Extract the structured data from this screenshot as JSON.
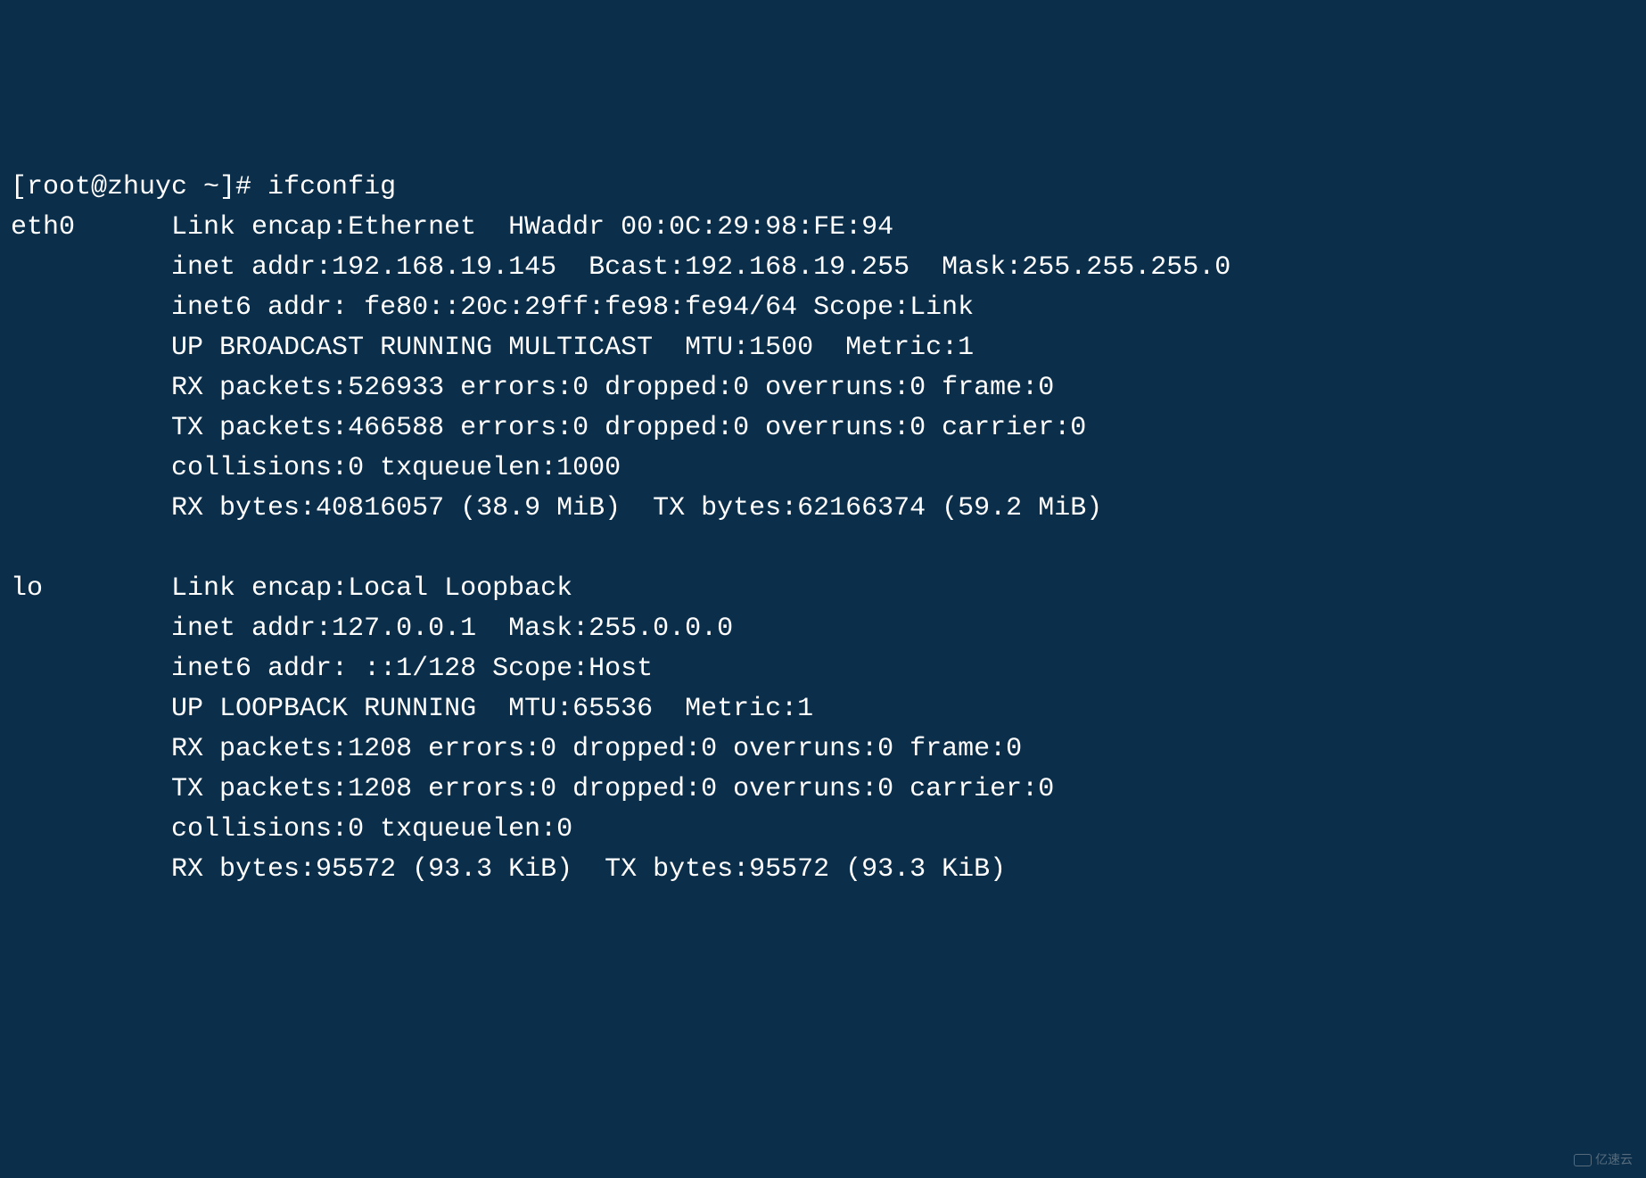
{
  "prompt": "[root@zhuyc ~]# ifconfig",
  "interfaces": {
    "eth0": {
      "name": "eth0",
      "line1": "Link encap:Ethernet  HWaddr 00:0C:29:98:FE:94",
      "line2": "inet addr:192.168.19.145  Bcast:192.168.19.255  Mask:255.255.255.0",
      "line3": "inet6 addr: fe80::20c:29ff:fe98:fe94/64 Scope:Link",
      "line4": "UP BROADCAST RUNNING MULTICAST  MTU:1500  Metric:1",
      "line5": "RX packets:526933 errors:0 dropped:0 overruns:0 frame:0",
      "line6": "TX packets:466588 errors:0 dropped:0 overruns:0 carrier:0",
      "line7": "collisions:0 txqueuelen:1000",
      "line8": "RX bytes:40816057 (38.9 MiB)  TX bytes:62166374 (59.2 MiB)"
    },
    "lo": {
      "name": "lo",
      "line1": "Link encap:Local Loopback",
      "line2": "inet addr:127.0.0.1  Mask:255.0.0.0",
      "line3": "inet6 addr: ::1/128 Scope:Host",
      "line4": "UP LOOPBACK RUNNING  MTU:65536  Metric:1",
      "line5": "RX packets:1208 errors:0 dropped:0 overruns:0 frame:0",
      "line6": "TX packets:1208 errors:0 dropped:0 overruns:0 carrier:0",
      "line7": "collisions:0 txqueuelen:0",
      "line8": "RX bytes:95572 (93.3 KiB)  TX bytes:95572 (93.3 KiB)"
    }
  },
  "watermark": "亿速云"
}
